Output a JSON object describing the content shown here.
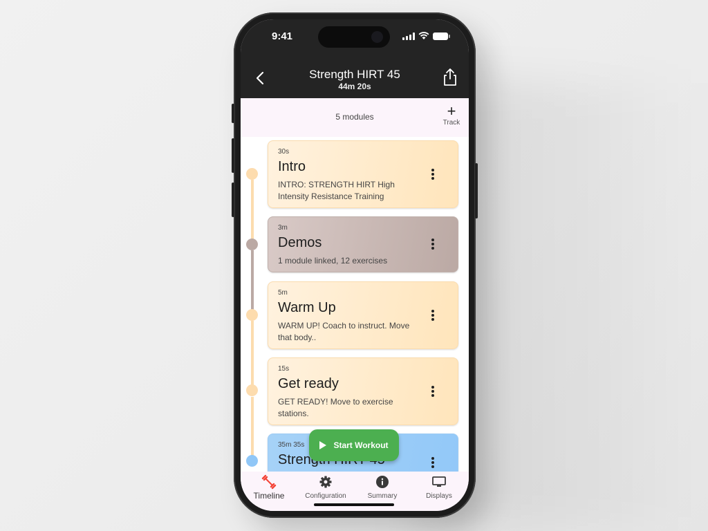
{
  "status_bar": {
    "time": "9:41"
  },
  "app_bar": {
    "title": "Strength HIRT 45",
    "subtitle": "44m 20s"
  },
  "toolbar": {
    "module_count": "5 modules",
    "track_label": "Track"
  },
  "modules": [
    {
      "duration": "30s",
      "name": "Intro",
      "description": "INTRO: STRENGTH HIRT High Intensity Resistance Training",
      "color": "#ffe5bb"
    },
    {
      "duration": "3m",
      "name": "Demos",
      "description": "1 module linked, 12 exercises",
      "color": "#bba9a4"
    },
    {
      "duration": "5m",
      "name": "Warm Up",
      "description": "WARM UP! Coach to instruct. Move that body..",
      "color": "#ffe5bb"
    },
    {
      "duration": "15s",
      "name": "Get ready",
      "description": "GET READY! Move to exercise stations.",
      "color": "#ffe5bb"
    },
    {
      "duration": "35m 35s",
      "name": "Strength HIRT 45",
      "description": "",
      "color": "#92c8f8"
    }
  ],
  "fab": {
    "label": "Start Workout",
    "color": "#4caf50"
  },
  "bottom_nav": [
    {
      "label": "Timeline",
      "icon": "dumbbell-icon",
      "active": true,
      "accent": "#f44336"
    },
    {
      "label": "Configuration",
      "icon": "gear-icon",
      "active": false
    },
    {
      "label": "Summary",
      "icon": "info-icon",
      "active": false
    },
    {
      "label": "Displays",
      "icon": "monitor-icon",
      "active": false
    }
  ]
}
